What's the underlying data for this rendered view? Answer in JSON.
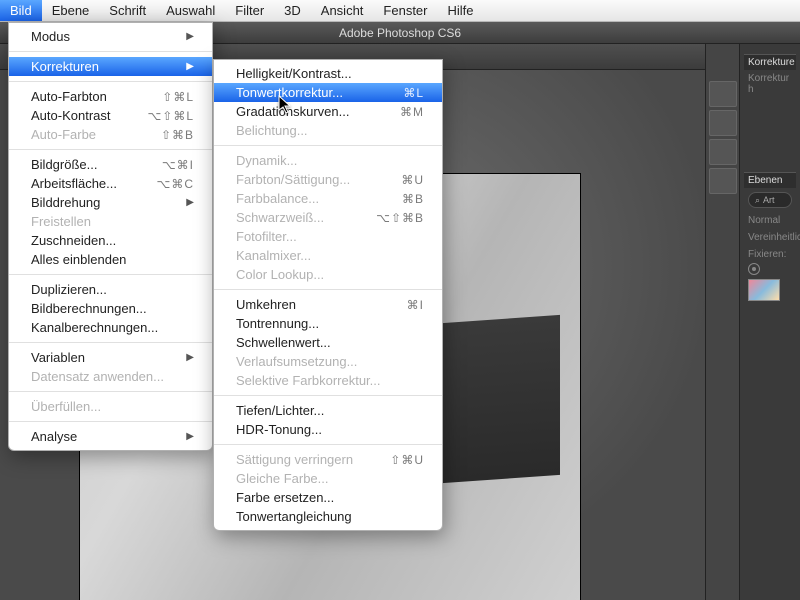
{
  "menubar": {
    "items": [
      "Bild",
      "Ebene",
      "Schrift",
      "Auswahl",
      "Filter",
      "3D",
      "Ansicht",
      "Fenster",
      "Hilfe"
    ],
    "open_index": 0
  },
  "app": {
    "title": "Adobe Photoshop CS6"
  },
  "main_menu": {
    "groups": [
      [
        {
          "label": "Modus",
          "shortcut": "",
          "submenu": true,
          "disabled": false
        }
      ],
      [
        {
          "label": "Korrekturen",
          "shortcut": "",
          "submenu": true,
          "disabled": false,
          "highlight": true
        }
      ],
      [
        {
          "label": "Auto-Farbton",
          "shortcut": "⇧⌘L",
          "disabled": false
        },
        {
          "label": "Auto-Kontrast",
          "shortcut": "⌥⇧⌘L",
          "disabled": false
        },
        {
          "label": "Auto-Farbe",
          "shortcut": "⇧⌘B",
          "disabled": true
        }
      ],
      [
        {
          "label": "Bildgröße...",
          "shortcut": "⌥⌘I",
          "disabled": false
        },
        {
          "label": "Arbeitsfläche...",
          "shortcut": "⌥⌘C",
          "disabled": false
        },
        {
          "label": "Bilddrehung",
          "shortcut": "",
          "submenu": true,
          "disabled": false
        },
        {
          "label": "Freistellen",
          "shortcut": "",
          "disabled": true
        },
        {
          "label": "Zuschneiden...",
          "shortcut": "",
          "disabled": false
        },
        {
          "label": "Alles einblenden",
          "shortcut": "",
          "disabled": false
        }
      ],
      [
        {
          "label": "Duplizieren...",
          "shortcut": "",
          "disabled": false
        },
        {
          "label": "Bildberechnungen...",
          "shortcut": "",
          "disabled": false
        },
        {
          "label": "Kanalberechnungen...",
          "shortcut": "",
          "disabled": false
        }
      ],
      [
        {
          "label": "Variablen",
          "shortcut": "",
          "submenu": true,
          "disabled": false
        },
        {
          "label": "Datensatz anwenden...",
          "shortcut": "",
          "disabled": true
        }
      ],
      [
        {
          "label": "Überfüllen...",
          "shortcut": "",
          "disabled": true
        }
      ],
      [
        {
          "label": "Analyse",
          "shortcut": "",
          "submenu": true,
          "disabled": false
        }
      ]
    ]
  },
  "sub_menu": {
    "groups": [
      [
        {
          "label": "Helligkeit/Kontrast...",
          "shortcut": "",
          "disabled": false
        },
        {
          "label": "Tonwertkorrektur...",
          "shortcut": "⌘L",
          "disabled": false,
          "highlight": true
        },
        {
          "label": "Gradationskurven...",
          "shortcut": "⌘M",
          "disabled": false
        },
        {
          "label": "Belichtung...",
          "shortcut": "",
          "disabled": true
        }
      ],
      [
        {
          "label": "Dynamik...",
          "shortcut": "",
          "disabled": true
        },
        {
          "label": "Farbton/Sättigung...",
          "shortcut": "⌘U",
          "disabled": true
        },
        {
          "label": "Farbbalance...",
          "shortcut": "⌘B",
          "disabled": true
        },
        {
          "label": "Schwarzweiß...",
          "shortcut": "⌥⇧⌘B",
          "disabled": true
        },
        {
          "label": "Fotofilter...",
          "shortcut": "",
          "disabled": true
        },
        {
          "label": "Kanalmixer...",
          "shortcut": "",
          "disabled": true
        },
        {
          "label": "Color Lookup...",
          "shortcut": "",
          "disabled": true
        }
      ],
      [
        {
          "label": "Umkehren",
          "shortcut": "⌘I",
          "disabled": false
        },
        {
          "label": "Tontrennung...",
          "shortcut": "",
          "disabled": false
        },
        {
          "label": "Schwellenwert...",
          "shortcut": "",
          "disabled": false
        },
        {
          "label": "Verlaufsumsetzung...",
          "shortcut": "",
          "disabled": true
        },
        {
          "label": "Selektive Farbkorrektur...",
          "shortcut": "",
          "disabled": true
        }
      ],
      [
        {
          "label": "Tiefen/Lichter...",
          "shortcut": "",
          "disabled": false
        },
        {
          "label": "HDR-Tonung...",
          "shortcut": "",
          "disabled": false
        }
      ],
      [
        {
          "label": "Sättigung verringern",
          "shortcut": "⇧⌘U",
          "disabled": true
        },
        {
          "label": "Gleiche Farbe...",
          "shortcut": "",
          "disabled": true
        },
        {
          "label": "Farbe ersetzen...",
          "shortcut": "",
          "disabled": false
        },
        {
          "label": "Tonwertangleichung",
          "shortcut": "",
          "disabled": false
        }
      ]
    ]
  },
  "right_panels": {
    "p1": "Korrekture",
    "p2": "Korrektur h",
    "layers_tab": "Ebenen",
    "search_placeholder": "Art",
    "blend": "Normal",
    "lock_label": "Fixieren:",
    "unify": "Vereinheitlic"
  }
}
